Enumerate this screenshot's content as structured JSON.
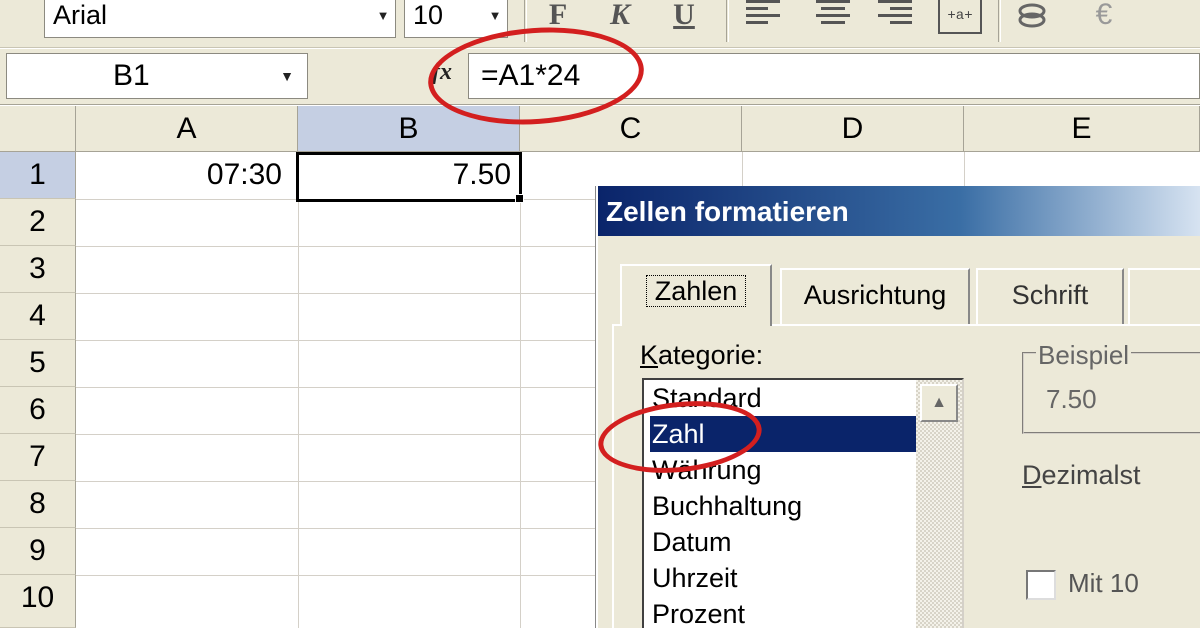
{
  "toolbar": {
    "font_name": "Arial",
    "font_size": "10",
    "bold_label": "F",
    "italic_label": "K",
    "underline_label": "U",
    "merge_label": "+a+",
    "euro_label": "€"
  },
  "formula_bar": {
    "name_box": "B1",
    "fx_label": "fx",
    "formula": "=A1*24"
  },
  "grid": {
    "columns": [
      "A",
      "B",
      "C",
      "D",
      "E"
    ],
    "rows": [
      "1",
      "2",
      "3",
      "4",
      "5",
      "6",
      "7",
      "8",
      "9",
      "10"
    ],
    "cells": {
      "A1": "07:30",
      "B1": "7.50"
    },
    "selected_cell": "B1"
  },
  "dialog": {
    "title": "Zellen formatieren",
    "tabs": [
      {
        "label": "Zahlen",
        "active": true
      },
      {
        "label": "Ausrichtung",
        "active": false
      },
      {
        "label": "Schrift",
        "active": false
      }
    ],
    "kategorie_label_first": "K",
    "kategorie_label_rest": "ategorie:",
    "categories": [
      "Standard",
      "Zahl",
      "Währung",
      "Buchhaltung",
      "Datum",
      "Uhrzeit",
      "Prozent"
    ],
    "selected_category": "Zahl",
    "beispiel_label": "Beispiel",
    "beispiel_value": "7.50",
    "dezimal_label_first": "D",
    "dezimal_label_rest": "ezimalst",
    "mit_label": "Mit 10"
  },
  "colors": {
    "highlight_oval": "#d31f1f",
    "selection": "#0a246a",
    "header_selected": "#c5cfe3"
  }
}
